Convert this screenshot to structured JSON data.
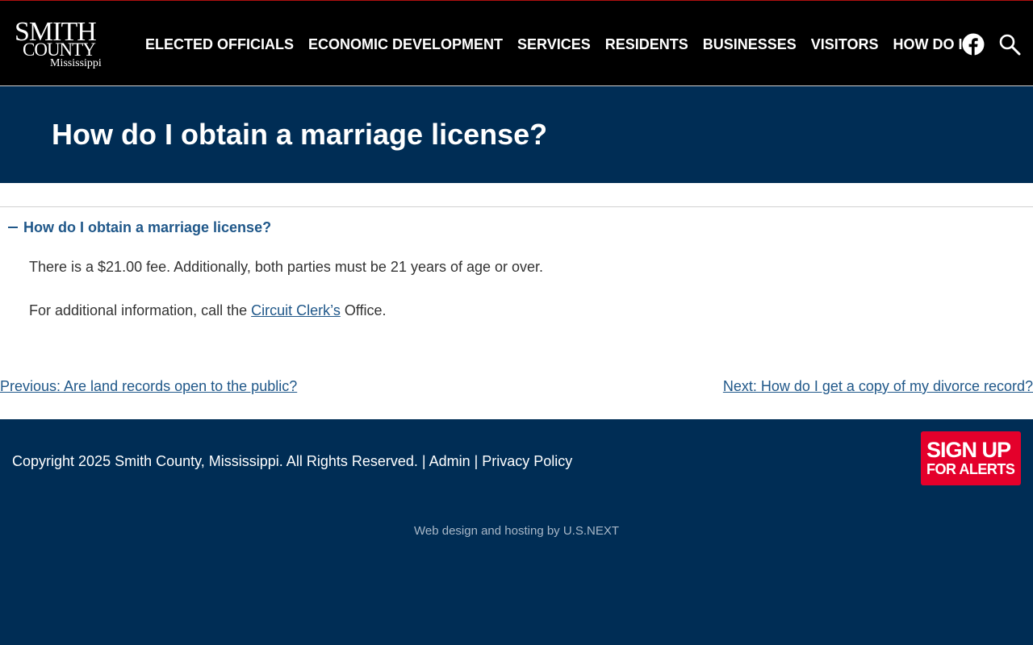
{
  "header": {
    "logo": {
      "line1": "SMITH",
      "line2": "COUNTY",
      "line3": "Mississippi"
    },
    "nav": [
      {
        "label": "ELECTED OFFICIALS"
      },
      {
        "label": "ECONOMIC DEVELOPMENT"
      },
      {
        "label": "SERVICES"
      },
      {
        "label": "RESIDENTS"
      },
      {
        "label": "BUSINESSES"
      },
      {
        "label": "VISITORS"
      },
      {
        "label": "HOW DO I?"
      }
    ],
    "icons": {
      "social": "facebook-icon",
      "search": "search-icon"
    }
  },
  "banner": {
    "title": "How do I obtain a marriage license?"
  },
  "faq": {
    "question": "How do I obtain a marriage license?",
    "expanded": true,
    "answer_line1": "There is a $21.00 fee. Additionally, both parties must be 21 years of age or over.",
    "answer_line2_before": "For additional information, call the ",
    "answer_line2_link": "Circuit Clerk’s",
    "answer_line2_after": " Office."
  },
  "pagination": {
    "previous": "Previous: Are land records open to the public?",
    "next": "Next: How do I get a copy of my divorce record?"
  },
  "footer": {
    "copyright": "Copyright 2025 Smith County, Mississippi. All Rights Reserved.",
    "separator": " | ",
    "admin": "Admin",
    "privacy": "Privacy Policy",
    "alerts_line1": "SIGN UP",
    "alerts_line2": "FOR ALERTS",
    "credit": "Web design and hosting by U.S.NEXT"
  },
  "colors": {
    "header_bg": "#000000",
    "brand_navy": "#002d55",
    "link_blue": "#1f5789",
    "alert_red": "#e4002b"
  }
}
